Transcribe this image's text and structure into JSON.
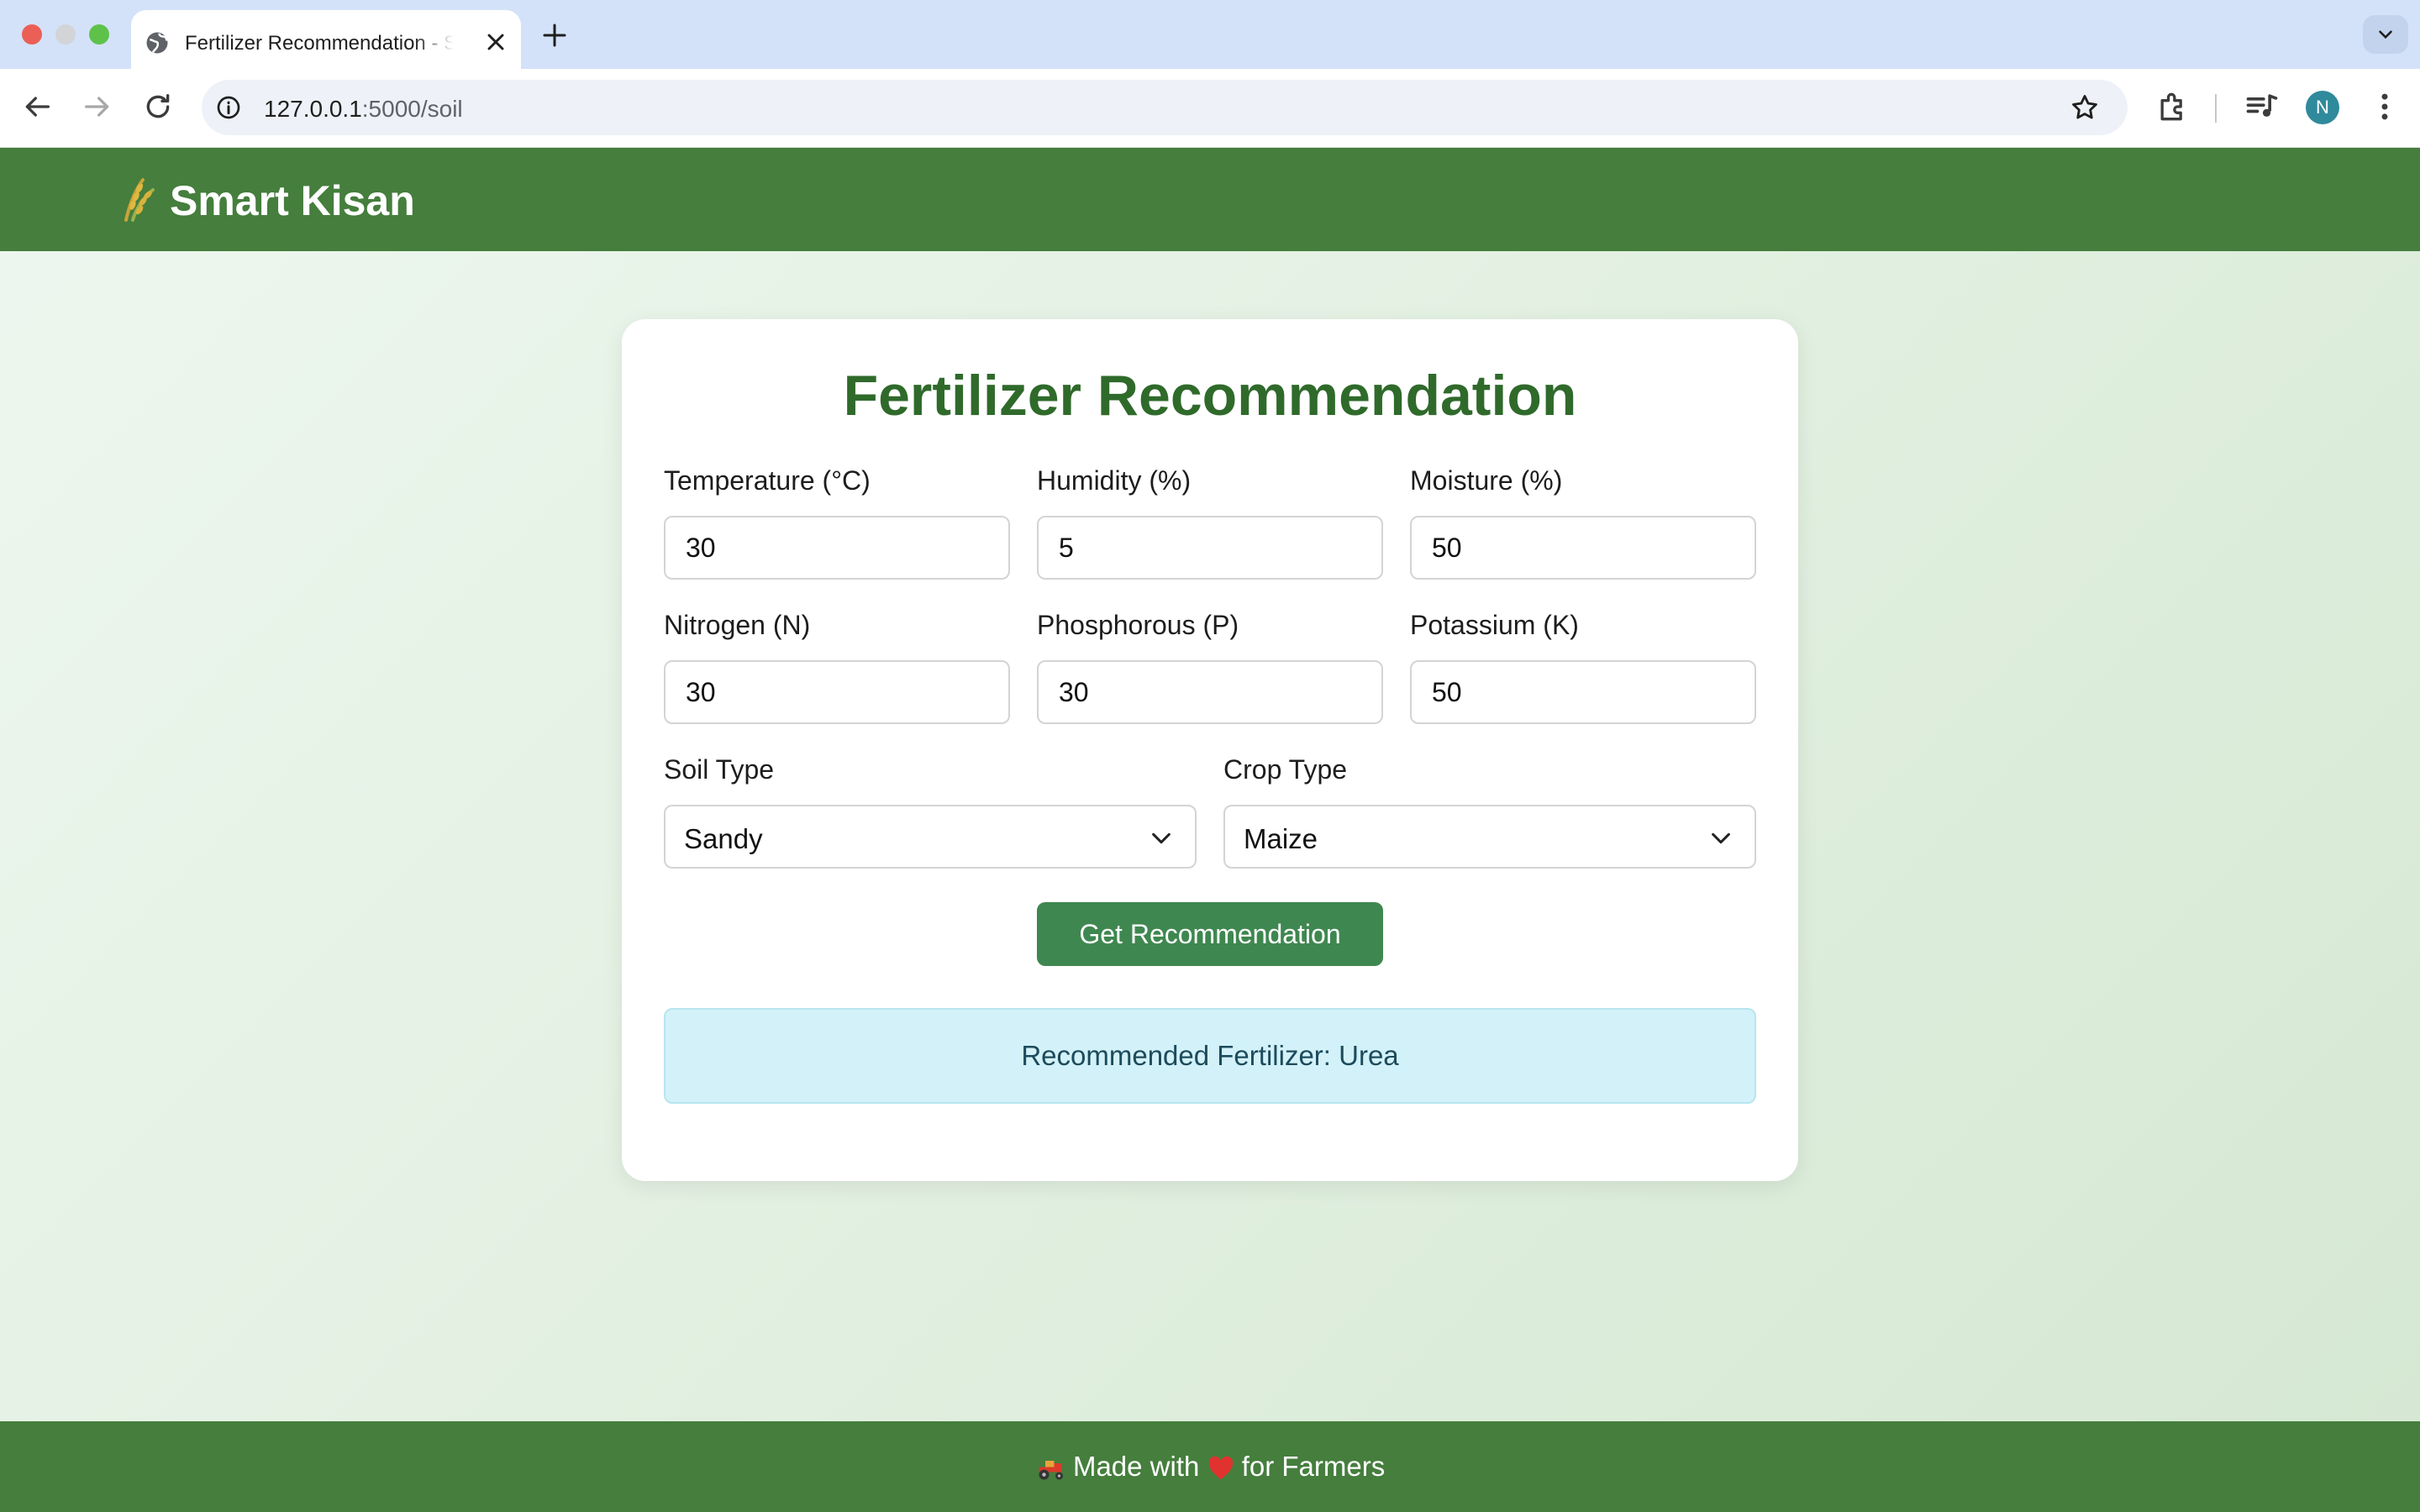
{
  "browser": {
    "tab_title": "Fertilizer Recommendation - Smart Kisan",
    "url_host": "127.0.0.1",
    "url_path": ":5000/soil",
    "profile_initial": "N"
  },
  "header": {
    "brand": "Smart Kisan"
  },
  "form": {
    "title": "Fertilizer Recommendation",
    "fields": [
      {
        "label": "Temperature (°C)",
        "value": "30"
      },
      {
        "label": "Humidity (%)",
        "value": "5"
      },
      {
        "label": "Moisture (%)",
        "value": "50"
      },
      {
        "label": "Nitrogen (N)",
        "value": "30"
      },
      {
        "label": "Phosphorous (P)",
        "value": "30"
      },
      {
        "label": "Potassium (K)",
        "value": "50"
      }
    ],
    "soil_type": {
      "label": "Soil Type",
      "value": "Sandy"
    },
    "crop_type": {
      "label": "Crop Type",
      "value": "Maize"
    },
    "submit_label": "Get Recommendation",
    "result_text": "Recommended Fertilizer: Urea"
  },
  "footer": {
    "text_before": "Made with",
    "text_after": "for Farmers"
  },
  "colors": {
    "header_green": "#457e3d",
    "title_green": "#2f6a2b",
    "button_green": "#3f8750",
    "result_bg": "#d3f1f8"
  }
}
